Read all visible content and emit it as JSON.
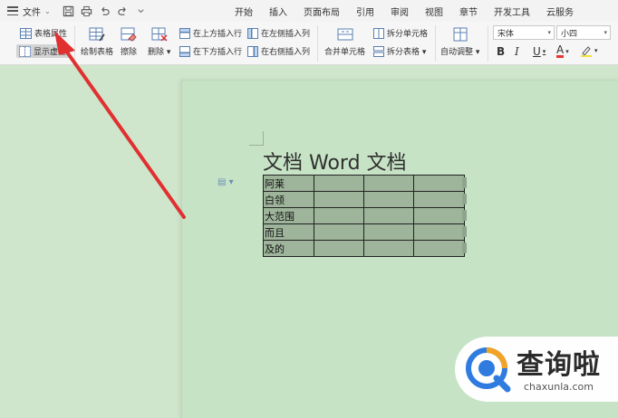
{
  "menubar": {
    "file_label": "文件",
    "tabs": [
      "开始",
      "插入",
      "页面布局",
      "引用",
      "审阅",
      "视图",
      "章节",
      "开发工具",
      "云服务"
    ]
  },
  "ribbon": {
    "table_properties": "表格属性",
    "show_gridlines": "显示虚框",
    "draw_table": "绘制表格",
    "eraser": "擦除",
    "delete": "删除",
    "insert_row_above": "在上方插入行",
    "insert_row_below": "在下方插入行",
    "insert_col_left": "在左侧插入列",
    "insert_col_right": "在右侧插入列",
    "merge_cells": "合并单元格",
    "split_cells": "拆分单元格",
    "split_table": "拆分表格",
    "auto_fit": "自动调整",
    "font_name": "宋体",
    "font_size": "小四",
    "bold": "B",
    "italic": "I",
    "underline": "U",
    "font_color": "A"
  },
  "document": {
    "title": "文档 Word 文档",
    "table_rows": [
      [
        "阿莱",
        "",
        "",
        ""
      ],
      [
        "白领",
        "",
        "",
        ""
      ],
      [
        "大范围",
        "",
        "",
        ""
      ],
      [
        "而且",
        "",
        "",
        ""
      ],
      [
        "及的",
        "",
        "",
        ""
      ]
    ]
  },
  "watermark": {
    "brand": "查询啦",
    "domain": "chaxunla.com"
  },
  "colors": {
    "arrow": "#e03030",
    "page_bg": "#c7e3c5",
    "cell_bg": "#9eb49b"
  }
}
